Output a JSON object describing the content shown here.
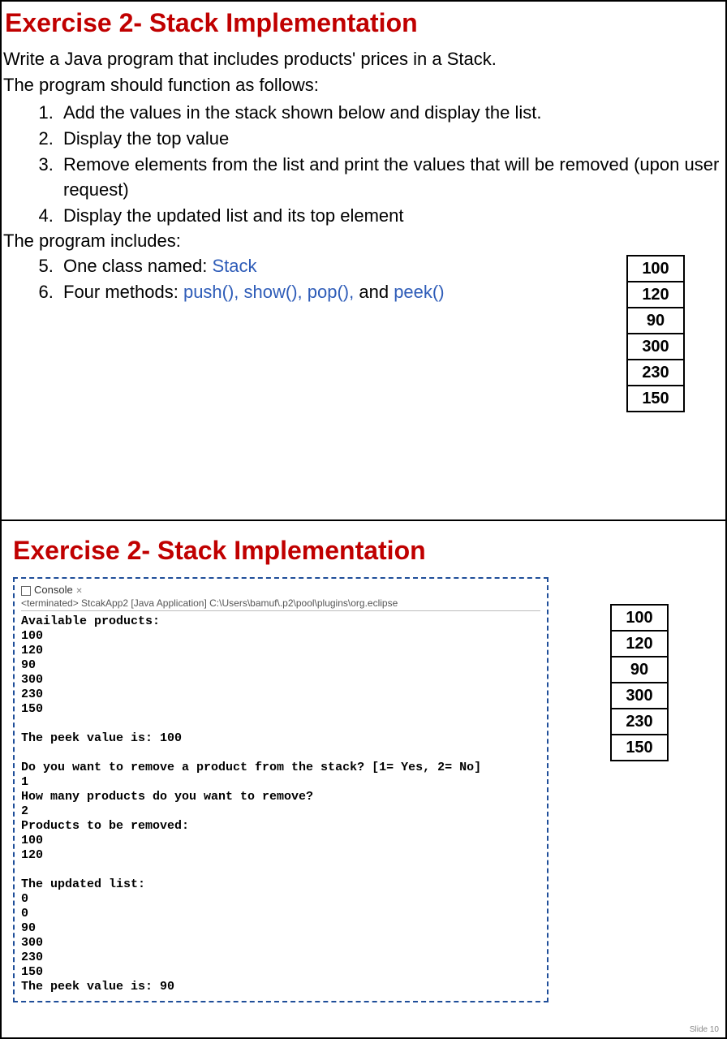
{
  "slide1": {
    "title": "Exercise 2- Stack Implementation",
    "desc1": "Write a Java program that includes products' prices in a Stack.",
    "desc2": "The program should function as follows:",
    "items": [
      "Add the values in the stack shown below and display the list.",
      "Display the top value",
      "Remove elements from the list and print the values that will be removed (upon user request)",
      "Display the updated list and its top element"
    ],
    "includes_label": "The program includes:",
    "includes": {
      "i5_pre": "One class named: ",
      "i5_kw": "Stack",
      "i6_pre": "Four methods: ",
      "i6_kw": "push(),  show(),  pop(),",
      "i6_mid": " and ",
      "i6_kw2": "peek()"
    },
    "stack": [
      "100",
      "120",
      "90",
      "300",
      "230",
      "150"
    ]
  },
  "slide2": {
    "title": "Exercise 2- Stack Implementation",
    "console_tab": "Console",
    "console_term": "<terminated> StcakApp2 [Java Application] C:\\Users\\bamuf\\.p2\\pool\\plugins\\org.eclipse",
    "console_body": "Available products:\n100\n120\n90\n300\n230\n150\n\nThe peek value is: 100\n\nDo you want to remove a product from the stack? [1= Yes, 2= No]\n1\nHow many products do you want to remove?\n2\nProducts to be removed:\n100\n120\n\nThe updated list:\n0\n0\n90\n300\n230\n150\nThe peek value is: 90",
    "stack": [
      "100",
      "120",
      "90",
      "300",
      "230",
      "150"
    ],
    "slide_num": "Slide 10"
  }
}
